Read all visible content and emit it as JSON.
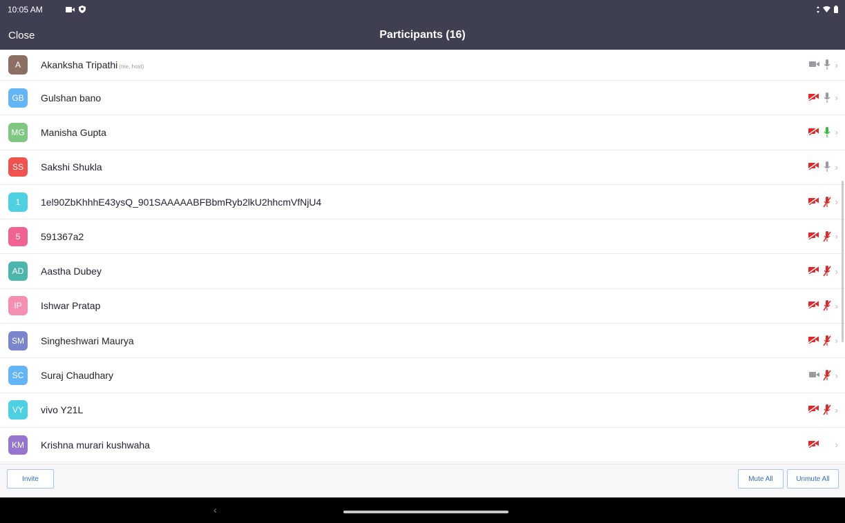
{
  "status": {
    "time": "10:05 AM"
  },
  "header": {
    "close_label": "Close",
    "title": "Participants (16)"
  },
  "participants": [
    {
      "initials": "A",
      "name": "Akanksha Tripathi",
      "tag": "(me, host)",
      "color": "#8d6e63",
      "video": "on",
      "mic": "on"
    },
    {
      "initials": "GB",
      "name": "Gulshan bano",
      "tag": "",
      "color": "#64b5f6",
      "video": "off",
      "mic": "on"
    },
    {
      "initials": "MG",
      "name": "Manisha Gupta",
      "tag": "",
      "color": "#81c784",
      "video": "off",
      "mic": "speaking"
    },
    {
      "initials": "SS",
      "name": "Sakshi Shukla",
      "tag": "",
      "color": "#ef5350",
      "video": "off",
      "mic": "on"
    },
    {
      "initials": "1",
      "name": "1el90ZbKhhhE43ysQ_901SAAAAABFBbmRyb2lkU2hhcmVfNjU4",
      "tag": "",
      "color": "#4dd0e1",
      "video": "off",
      "mic": "muted"
    },
    {
      "initials": "5",
      "name": "591367a2",
      "tag": "",
      "color": "#f06292",
      "video": "off",
      "mic": "muted"
    },
    {
      "initials": "AD",
      "name": "Aastha Dubey",
      "tag": "",
      "color": "#4db6ac",
      "video": "off",
      "mic": "muted"
    },
    {
      "initials": "IP",
      "name": "Ishwar Pratap",
      "tag": "",
      "color": "#f48fb1",
      "video": "off",
      "mic": "muted"
    },
    {
      "initials": "SM",
      "name": "Singheshwari Maurya",
      "tag": "",
      "color": "#7986cb",
      "video": "off",
      "mic": "muted"
    },
    {
      "initials": "SC",
      "name": "Suraj Chaudhary",
      "tag": "",
      "color": "#64b5f6",
      "video": "on",
      "mic": "muted"
    },
    {
      "initials": "VY",
      "name": "vivo Y21L",
      "tag": "",
      "color": "#4dd0e1",
      "video": "off",
      "mic": "muted"
    },
    {
      "initials": "KM",
      "name": "Krishna murari kushwaha",
      "tag": "",
      "color": "#9575cd",
      "video": "off",
      "mic": "none"
    }
  ],
  "footer": {
    "invite_label": "Invite",
    "mute_all_label": "Mute All",
    "unmute_all_label": "Unmute All"
  },
  "nav": {
    "back_glyph": "‹"
  }
}
